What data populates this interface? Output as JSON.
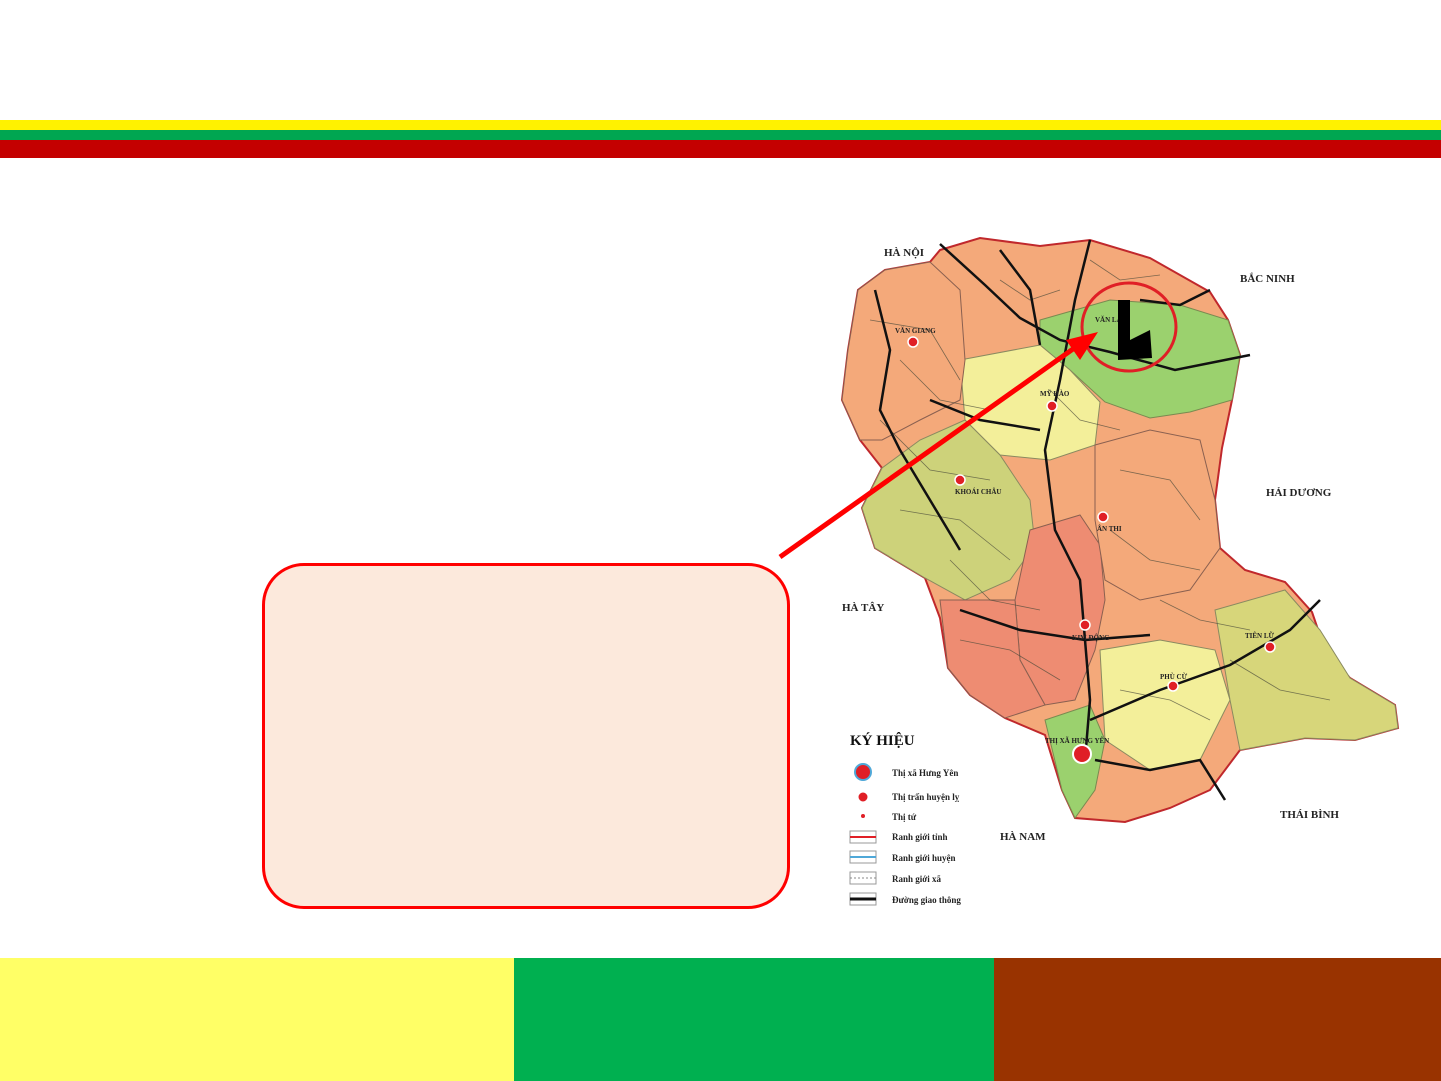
{
  "colors": {
    "stripe_yellow": "#fff200",
    "stripe_green": "#00a651",
    "stripe_red": "#c40000",
    "footer_yellow": "#ffff66",
    "footer_green": "#00b050",
    "footer_brown": "#993300",
    "callout_fill": "#fce9dc",
    "callout_border": "#ff0000",
    "arrow": "#ff0000"
  },
  "map": {
    "neighbors": {
      "ha_noi": "HÀ NỘI",
      "bac_ninh": "BẮC NINH",
      "hai_duong": "HẢI DƯƠNG",
      "ha_tay": "HÀ TÂY",
      "ha_nam": "HÀ NAM",
      "thai_binh": "THÁI BÌNH"
    },
    "towns": {
      "van_giang": "VĂN GIANG",
      "van_lam": "VĂN LÂM",
      "my_hao": "MỸ HÀO",
      "khoai_chau": "KHOÁI CHÂU",
      "an_thi": "ÂN THI",
      "kim_dong": "KIM ĐỘNG",
      "phu_cu": "PHÙ CỪ",
      "tien_lu": "TIÊN LỮ",
      "hung_yen": "THỊ XÃ HƯNG YÊN"
    },
    "legend": {
      "title": "KÝ HIỆU",
      "items": [
        "Thị xã Hưng Yên",
        "Thị trấn huyện lỵ",
        "Thị tứ",
        "Ranh giới tỉnh",
        "Ranh giới huyện",
        "Ranh giới xã",
        "Đường giao thông"
      ]
    }
  }
}
